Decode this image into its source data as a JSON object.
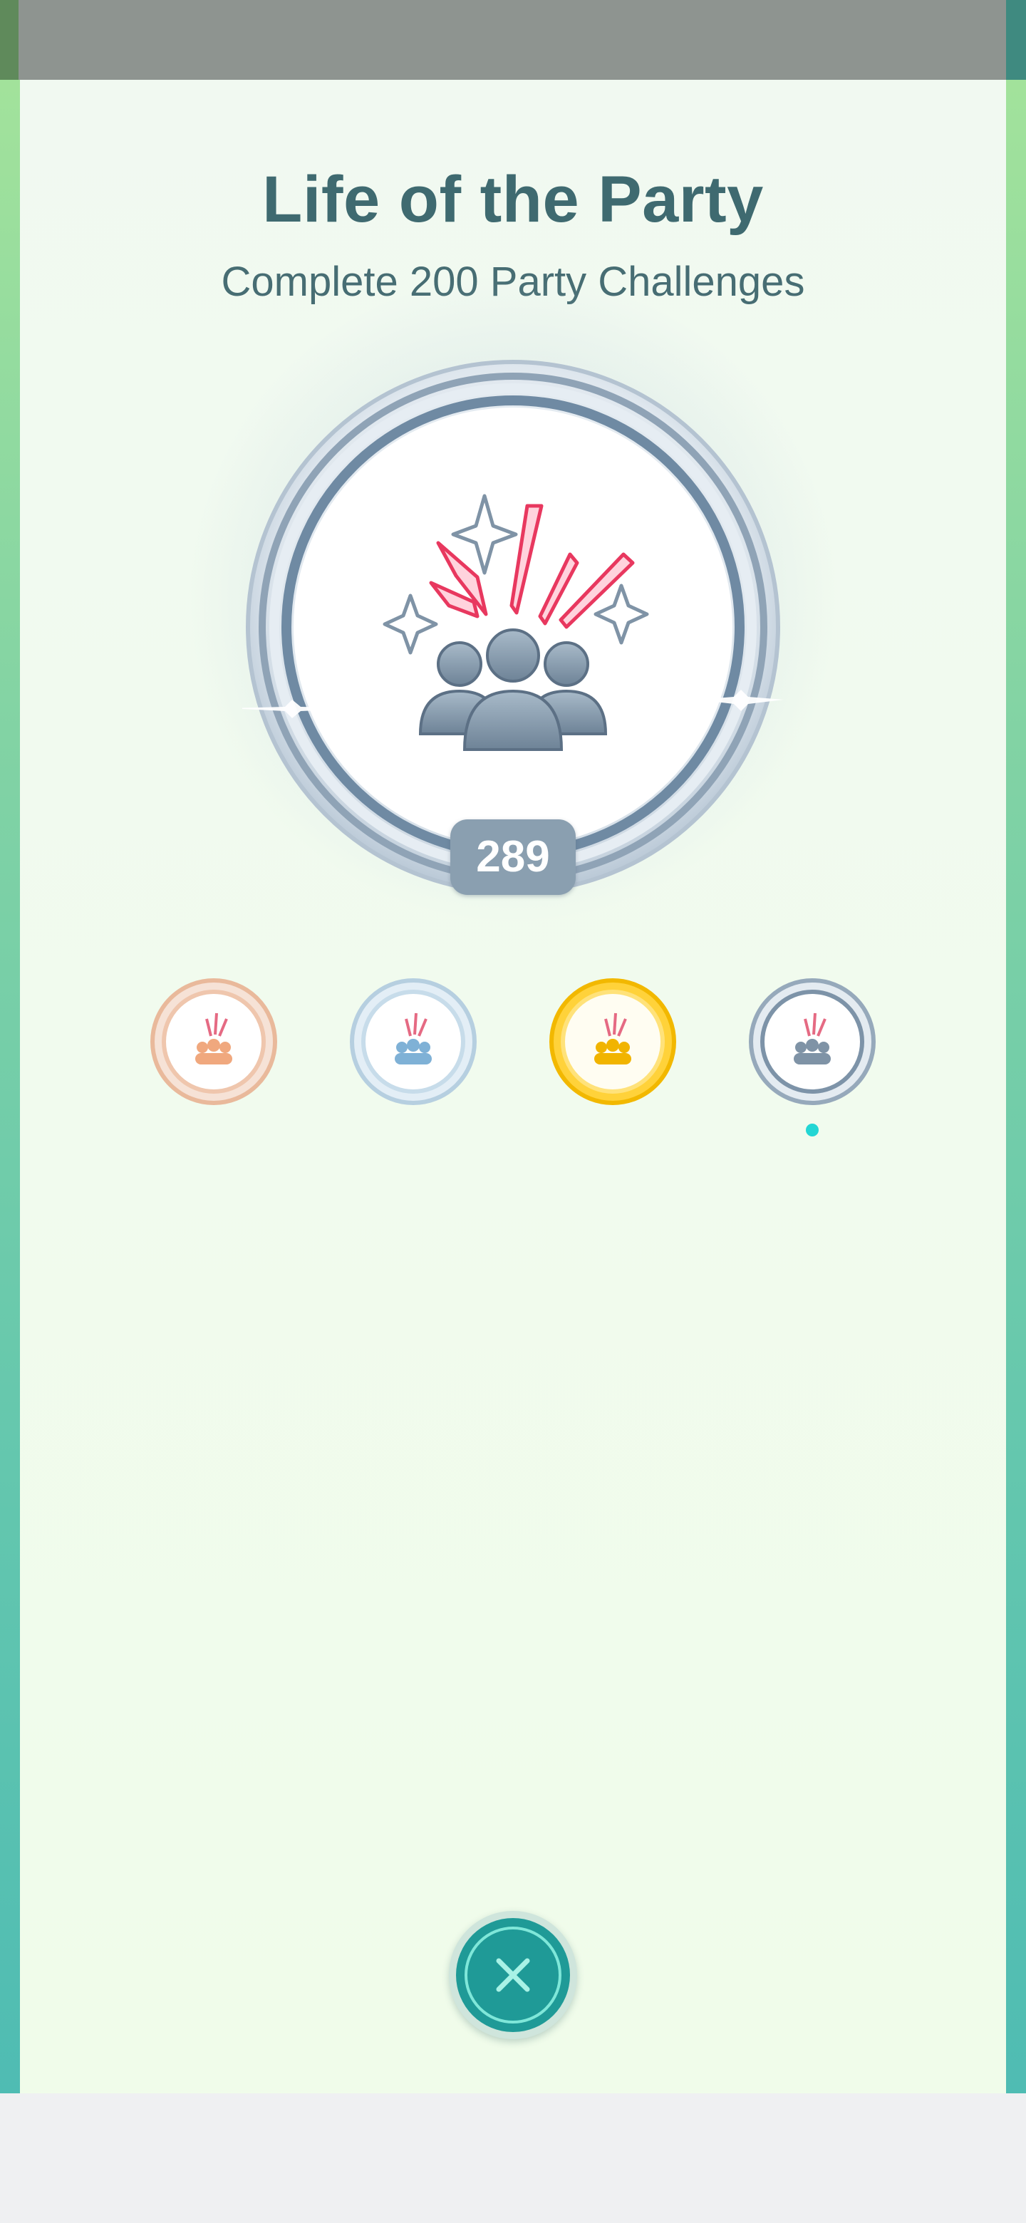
{
  "badge": {
    "title": "Life of the Party",
    "subtitle": "Complete 200 Party Challenges",
    "count": "289",
    "current_tier": "platinum"
  },
  "tiers": [
    {
      "name": "bronze"
    },
    {
      "name": "silver"
    },
    {
      "name": "gold"
    },
    {
      "name": "platinum",
      "selected": true
    }
  ],
  "colors": {
    "title": "#3f6a70",
    "accent_dot": "#23d6d4",
    "firework_red": "#e8385f",
    "platinum_icon": "#7f93a6"
  },
  "icons": {
    "close": "close-icon",
    "badge": "party-fireworks-icon"
  }
}
